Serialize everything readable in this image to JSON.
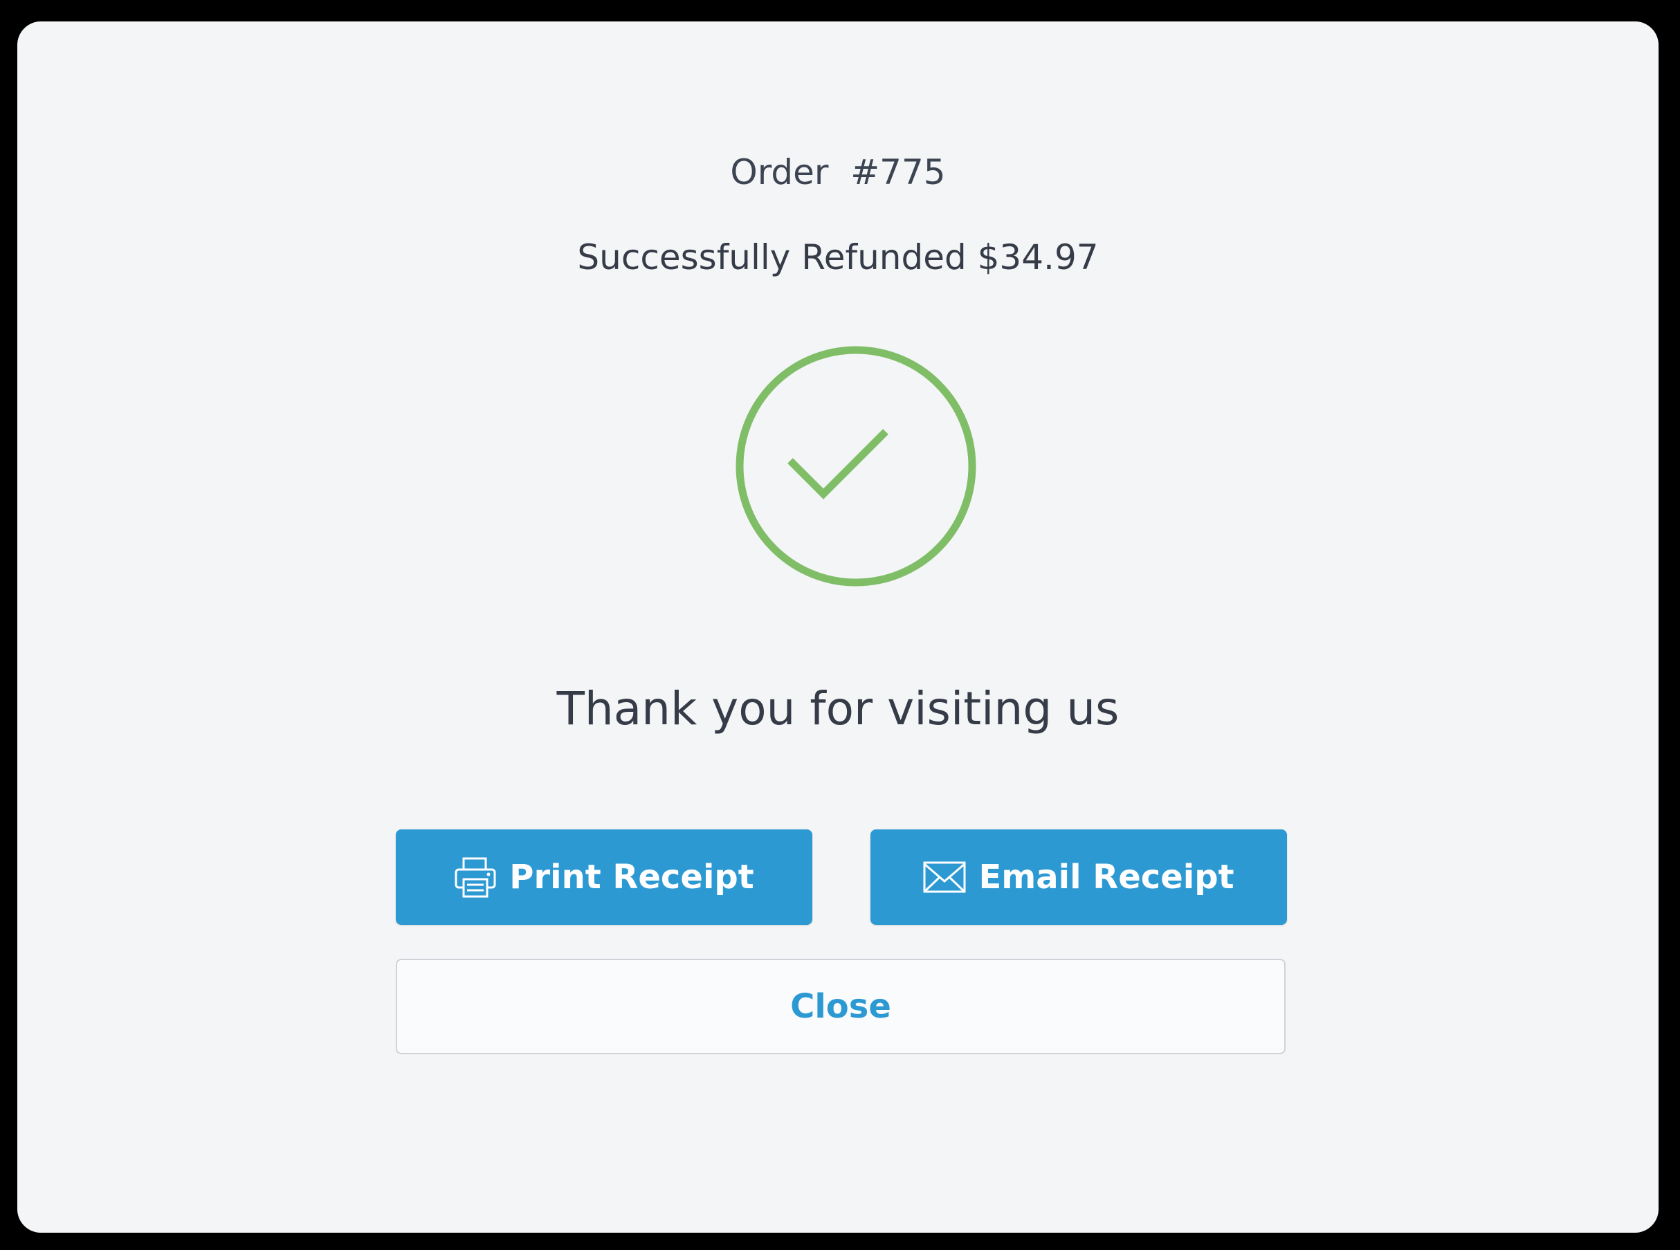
{
  "order": {
    "label": "Order  #775"
  },
  "status": {
    "refund_message": "Successfully Refunded $34.97"
  },
  "message": {
    "thanks": "Thank you for visiting us"
  },
  "actions": {
    "print_label": "Print Receipt",
    "print_icon": "printer-icon",
    "email_label": "Email Receipt",
    "email_icon": "envelope-icon",
    "close_label": "Close"
  },
  "colors": {
    "accent_blue": "#2d99d3",
    "success_green": "#7fbe67",
    "text_dark": "#353c48",
    "background": "#f4f5f7"
  }
}
